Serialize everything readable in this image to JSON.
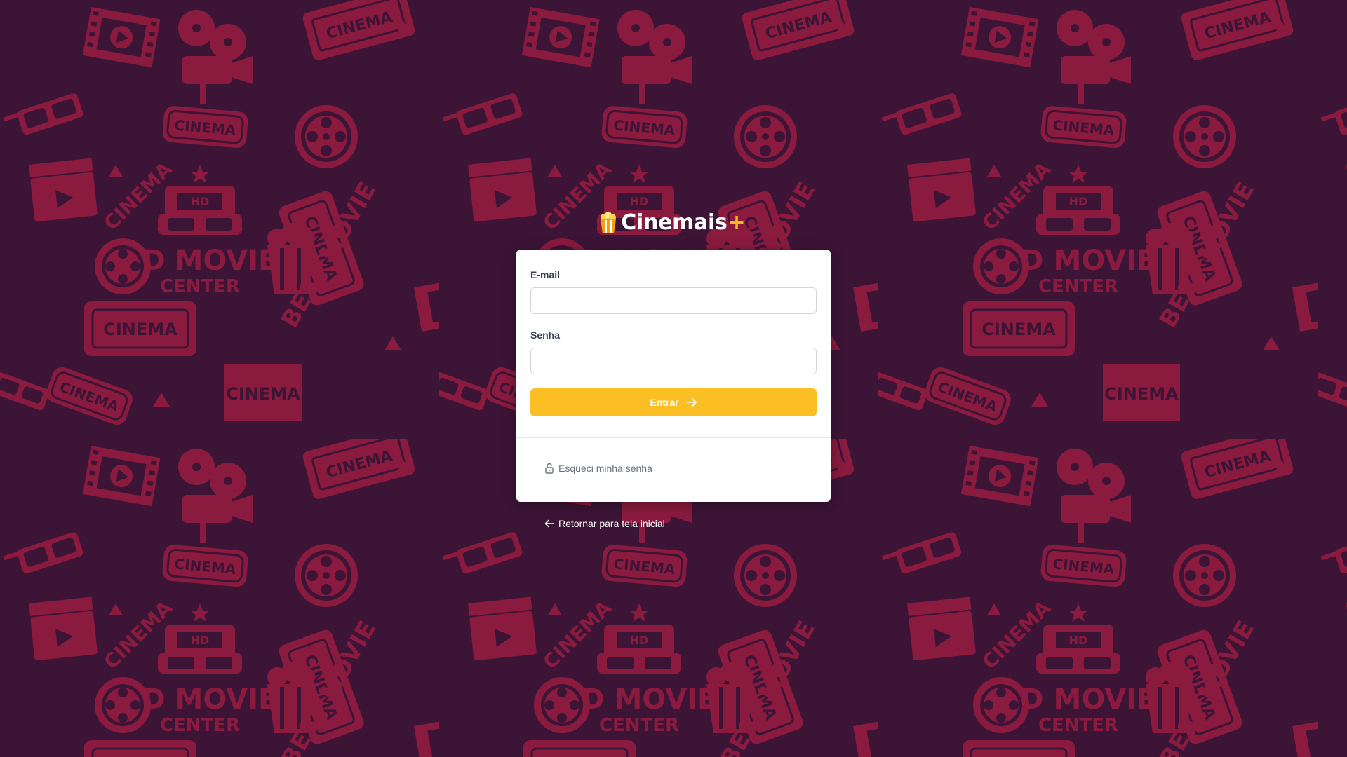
{
  "brand": {
    "name": "Cinemais",
    "plus": "+"
  },
  "form": {
    "email_label": "E-mail",
    "email_value": "",
    "password_label": "Senha",
    "password_value": "",
    "submit_label": "Entrar"
  },
  "links": {
    "forgot": "Esqueci minha senha",
    "back": "Retornar para tela inicial"
  },
  "colors": {
    "background": "#3c1436",
    "pattern": "#8a1a3e",
    "accent": "#fbbf24",
    "brand_plus": "#f5b81e"
  },
  "icons": {
    "brand": "popcorn-icon",
    "submit": "arrow-right-icon",
    "forgot": "unlock-icon",
    "back": "arrow-left-icon"
  }
}
